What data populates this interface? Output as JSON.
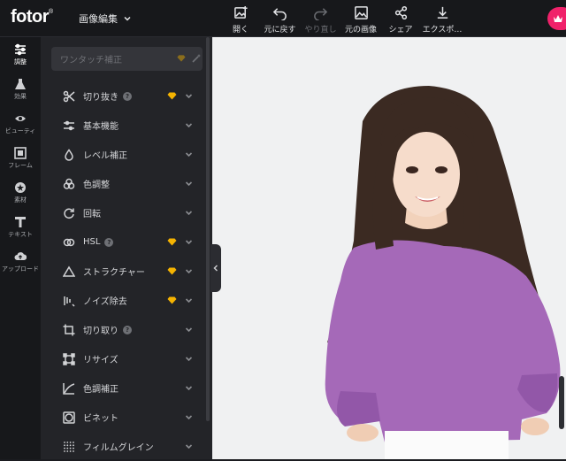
{
  "app": {
    "logo": "fotor",
    "logo_mark": "®",
    "mode": "画像編集"
  },
  "toolbar": [
    {
      "label": "開く",
      "icon": "open-image-icon",
      "enabled": true
    },
    {
      "label": "元に戻す",
      "icon": "undo-icon",
      "enabled": true
    },
    {
      "label": "やり直し",
      "icon": "redo-icon",
      "enabled": false
    },
    {
      "label": "元の画像",
      "icon": "original-image-icon",
      "enabled": true
    },
    {
      "label": "シェア",
      "icon": "share-icon",
      "enabled": true
    },
    {
      "label": "エクスポ…",
      "icon": "export-icon",
      "enabled": true
    }
  ],
  "nav": [
    {
      "label": "調整",
      "icon": "sliders-icon",
      "active": true
    },
    {
      "label": "効果",
      "icon": "flask-icon",
      "active": false
    },
    {
      "label": "ビューティ",
      "icon": "eye-icon",
      "active": false
    },
    {
      "label": "フレーム",
      "icon": "frame-icon",
      "active": false
    },
    {
      "label": "素材",
      "icon": "sticker-icon",
      "active": false
    },
    {
      "label": "テキスト",
      "icon": "text-icon",
      "active": false
    },
    {
      "label": "アップロード",
      "icon": "upload-cloud-icon",
      "active": false
    }
  ],
  "search": {
    "placeholder": "ワンタッチ補正"
  },
  "menu": [
    {
      "label": "切り抜き",
      "icon": "scissors-icon",
      "help": true,
      "premium": true
    },
    {
      "label": "基本機能",
      "icon": "sliders-icon",
      "help": false,
      "premium": false
    },
    {
      "label": "レベル補正",
      "icon": "drop-icon",
      "help": false,
      "premium": false
    },
    {
      "label": "色調整",
      "icon": "color-circles-icon",
      "help": false,
      "premium": false
    },
    {
      "label": "回転",
      "icon": "rotate-icon",
      "help": false,
      "premium": false
    },
    {
      "label": "HSL",
      "icon": "hsl-icon",
      "help": true,
      "premium": true
    },
    {
      "label": "ストラクチャー",
      "icon": "triangle-icon",
      "help": false,
      "premium": true
    },
    {
      "label": "ノイズ除去",
      "icon": "noise-icon",
      "help": false,
      "premium": true
    },
    {
      "label": "切り取り",
      "icon": "crop-icon",
      "help": true,
      "premium": false
    },
    {
      "label": "リサイズ",
      "icon": "resize-icon",
      "help": false,
      "premium": false
    },
    {
      "label": "色調補正",
      "icon": "curve-icon",
      "help": false,
      "premium": false
    },
    {
      "label": "ビネット",
      "icon": "vignette-icon",
      "help": false,
      "premium": false
    },
    {
      "label": "フィルムグレイン",
      "icon": "grain-icon",
      "help": false,
      "premium": false
    }
  ],
  "colors": {
    "accent": "#f0216a",
    "premium": "#f5b301",
    "bg": "#1b1c20",
    "panel": "#232428",
    "canvas": "#f0f1f2"
  }
}
